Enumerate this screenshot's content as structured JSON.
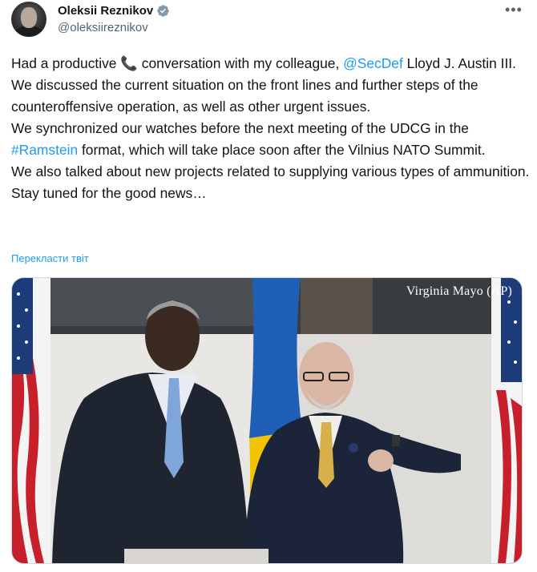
{
  "author": {
    "name": "Oleksii Reznikov",
    "handle": "@oleksiireznikov",
    "verified": true,
    "avatar_icon": "avatar-photo"
  },
  "menu_icon": "more-horizontal-icon",
  "body": {
    "line1_before": "Had a productive ",
    "line1_emoji": "📞",
    "line1_mid": " conversation with my colleague, ",
    "line1_mention": "@SecDef",
    "line1_after": " Lloyd J. Austin III.",
    "line2": "We discussed the current situation on the front lines and further steps of the counteroffensive operation, as well as other urgent issues.",
    "line3_before": "We synchronized our watches before the next meeting of the UDCG in the ",
    "line3_hashtag": "#Ramstein",
    "line3_after": " format, which will take place soon after the Vilnius NATO Summit.",
    "line4": "We also talked about new projects related to supplying various types of ammunition. Stay tuned for the good news…"
  },
  "translate_label": "Перекласти твіт",
  "media": {
    "credit": "Virginia Mayo (AP)"
  },
  "colors": {
    "link": "#1d9bf0",
    "text": "#0f1419",
    "muted": "#536471",
    "flag_blue": "#1f5fb5",
    "flag_yellow": "#f2c300"
  }
}
